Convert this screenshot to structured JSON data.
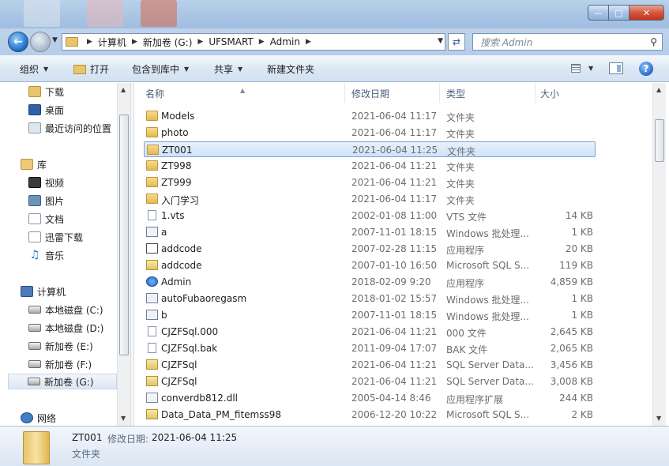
{
  "window": {
    "minimize_glyph": "—",
    "maximize_glyph": "□",
    "close_glyph": "✕"
  },
  "address": {
    "crumbs": [
      "计算机",
      "新加卷 (G:)",
      "UFSMART",
      "Admin"
    ],
    "search_placeholder": "搜索 Admin"
  },
  "toolbar": {
    "organize": "组织",
    "open": "打开",
    "include_library": "包含到库中",
    "share": "共享",
    "new_folder": "新建文件夹"
  },
  "nav": {
    "favorites": [
      "下载",
      "桌面",
      "最近访问的位置"
    ],
    "library_label": "库",
    "libraries": [
      "视频",
      "图片",
      "文档",
      "迅雷下载",
      "音乐"
    ],
    "computer_label": "计算机",
    "drives": [
      "本地磁盘 (C:)",
      "本地磁盘 (D:)",
      "新加卷 (E:)",
      "新加卷 (F:)",
      "新加卷 (G:)"
    ],
    "network_label": "网络"
  },
  "columns": {
    "name": "名称",
    "date": "修改日期",
    "type": "类型",
    "size": "大小"
  },
  "files": [
    {
      "name": "Models",
      "date": "2021-06-04 11:17",
      "type": "文件夹",
      "size": "",
      "icon": "folder"
    },
    {
      "name": "photo",
      "date": "2021-06-04 11:17",
      "type": "文件夹",
      "size": "",
      "icon": "folder"
    },
    {
      "name": "ZT001",
      "date": "2021-06-04 11:25",
      "type": "文件夹",
      "size": "",
      "icon": "folder"
    },
    {
      "name": "ZT998",
      "date": "2021-06-04 11:21",
      "type": "文件夹",
      "size": "",
      "icon": "folder"
    },
    {
      "name": "ZT999",
      "date": "2021-06-04 11:21",
      "type": "文件夹",
      "size": "",
      "icon": "folder"
    },
    {
      "name": "入门学习",
      "date": "2021-06-04 11:17",
      "type": "文件夹",
      "size": "",
      "icon": "folder"
    },
    {
      "name": "1.vts",
      "date": "2002-01-08 11:00",
      "type": "VTS 文件",
      "size": "14 KB",
      "icon": "file"
    },
    {
      "name": "a",
      "date": "2007-11-01 18:15",
      "type": "Windows 批处理...",
      "size": "1 KB",
      "icon": "bat"
    },
    {
      "name": "addcode",
      "date": "2007-02-28 11:15",
      "type": "应用程序",
      "size": "20 KB",
      "icon": "exe"
    },
    {
      "name": "addcode",
      "date": "2007-01-10 16:50",
      "type": "Microsoft SQL S...",
      "size": "119 KB",
      "icon": "sql"
    },
    {
      "name": "Admin",
      "date": "2018-02-09 9:20",
      "type": "应用程序",
      "size": "4,859 KB",
      "icon": "admin"
    },
    {
      "name": "autoFubaoregasm",
      "date": "2018-01-02 15:57",
      "type": "Windows 批处理...",
      "size": "1 KB",
      "icon": "bat"
    },
    {
      "name": "b",
      "date": "2007-11-01 18:15",
      "type": "Windows 批处理...",
      "size": "1 KB",
      "icon": "bat"
    },
    {
      "name": "CJZFSql.000",
      "date": "2021-06-04 11:21",
      "type": "000 文件",
      "size": "2,645 KB",
      "icon": "file"
    },
    {
      "name": "CJZFSql.bak",
      "date": "2011-09-04 17:07",
      "type": "BAK 文件",
      "size": "2,065 KB",
      "icon": "file"
    },
    {
      "name": "CJZFSql",
      "date": "2021-06-04 11:21",
      "type": "SQL Server Data...",
      "size": "3,456 KB",
      "icon": "sql"
    },
    {
      "name": "CJZFSql",
      "date": "2021-06-04 11:21",
      "type": "SQL Server Data...",
      "size": "3,008 KB",
      "icon": "sql"
    },
    {
      "name": "converdb812.dll",
      "date": "2005-04-14 8:46",
      "type": "应用程序扩展",
      "size": "244 KB",
      "icon": "dll"
    },
    {
      "name": "Data_Data_PM_fitemss98",
      "date": "2006-12-20 10:22",
      "type": "Microsoft SQL S...",
      "size": "2 KB",
      "icon": "sql"
    }
  ],
  "details": {
    "name": "ZT001",
    "modified_label": "修改日期:",
    "modified": "2021-06-04 11:25",
    "type": "文件夹"
  },
  "colors": {
    "accent": "#7da2ce",
    "selection": "#cfe3f9",
    "folder": "#e4b94f"
  }
}
